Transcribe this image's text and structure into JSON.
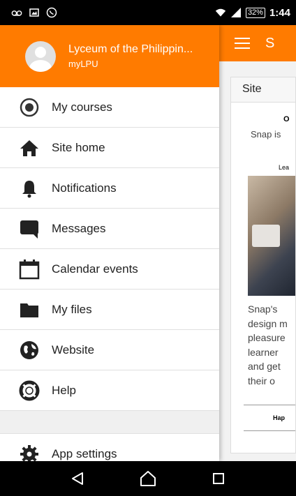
{
  "status_bar": {
    "time": "1:44",
    "battery": "32%",
    "icons": [
      "voicemail-icon",
      "image-icon",
      "whatsapp-icon",
      "wifi-icon",
      "signal-icon",
      "battery-icon"
    ]
  },
  "app": {
    "title_partial": "S",
    "card": {
      "tab": "Site",
      "line1": "O",
      "line2": "Snap is",
      "line3": "Lea",
      "paragraph": [
        "Snap's",
        "design m",
        "pleasure",
        "learner",
        "and get",
        "their o"
      ],
      "footer": "Hap"
    }
  },
  "drawer": {
    "site_name": "Lyceum of the Philippin...",
    "site_sub": "myLPU",
    "items": [
      {
        "label": "My courses",
        "icon": "my-courses-icon"
      },
      {
        "label": "Site home",
        "icon": "home-icon"
      },
      {
        "label": "Notifications",
        "icon": "bell-icon"
      },
      {
        "label": "Messages",
        "icon": "message-icon"
      },
      {
        "label": "Calendar events",
        "icon": "calendar-icon"
      },
      {
        "label": "My files",
        "icon": "folder-icon"
      },
      {
        "label": "Website",
        "icon": "globe-icon"
      },
      {
        "label": "Help",
        "icon": "lifebuoy-icon"
      }
    ],
    "settings_label": "App settings"
  },
  "navbar": {
    "icons": [
      "back-icon",
      "home-icon",
      "recents-icon"
    ]
  },
  "colors": {
    "accent": "#ff7b00",
    "icon": "#333333"
  }
}
